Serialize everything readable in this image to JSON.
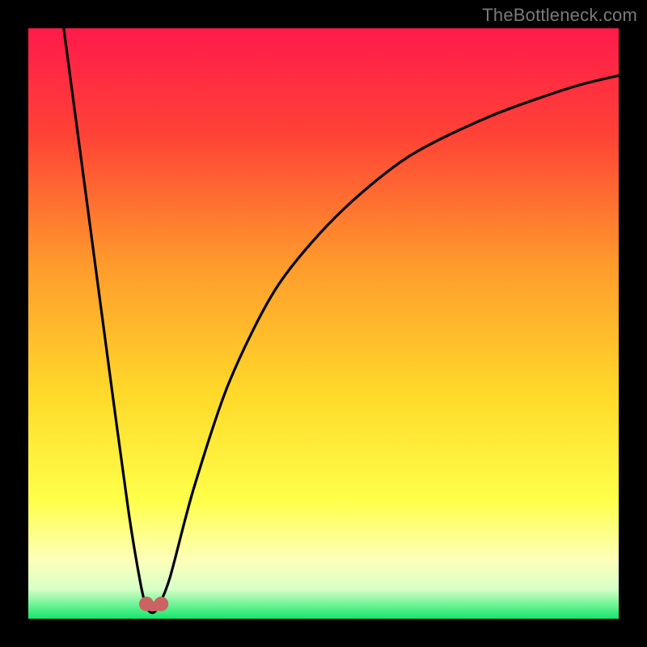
{
  "attribution": "TheBottleneck.com",
  "colors": {
    "top": "#ff1a4b",
    "mid_upper": "#ff6a2e",
    "mid": "#ffcf2a",
    "mid_lower": "#ffff62",
    "pale": "#fcffd5",
    "bottom": "#13e66b",
    "curve": "#000000",
    "marker": "#cb6263",
    "frame": "#000000"
  },
  "chart_data": {
    "type": "line",
    "title": "",
    "xlabel": "",
    "ylabel": "",
    "xlim": [
      0,
      100
    ],
    "ylim": [
      0,
      100
    ],
    "x_optimum": 21,
    "series": [
      {
        "name": "bottleneck-curve",
        "points": [
          {
            "x": 6,
            "y": 100
          },
          {
            "x": 10,
            "y": 70
          },
          {
            "x": 14,
            "y": 40
          },
          {
            "x": 17,
            "y": 18
          },
          {
            "x": 19,
            "y": 6
          },
          {
            "x": 20,
            "y": 2
          },
          {
            "x": 21,
            "y": 1
          },
          {
            "x": 22,
            "y": 2
          },
          {
            "x": 24,
            "y": 7
          },
          {
            "x": 28,
            "y": 22
          },
          {
            "x": 34,
            "y": 40
          },
          {
            "x": 42,
            "y": 56
          },
          {
            "x": 52,
            "y": 68
          },
          {
            "x": 64,
            "y": 78
          },
          {
            "x": 78,
            "y": 85
          },
          {
            "x": 92,
            "y": 90
          },
          {
            "x": 100,
            "y": 92
          }
        ]
      }
    ],
    "markers": [
      {
        "x": 20,
        "y": 2.5
      },
      {
        "x": 22.5,
        "y": 2.5
      }
    ]
  }
}
